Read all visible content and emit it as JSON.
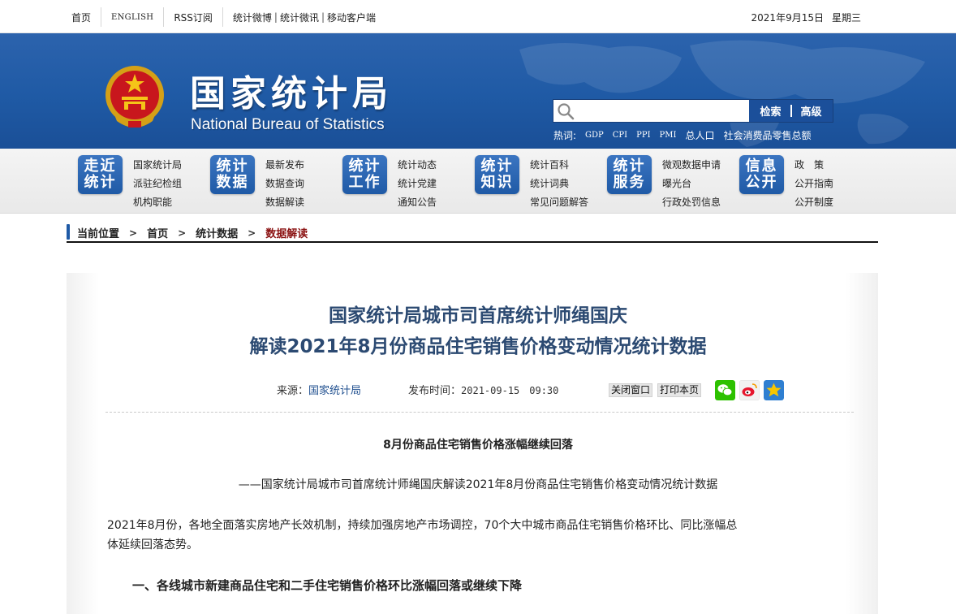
{
  "topbar": {
    "links": [
      "首页",
      "ENGLISH",
      "RSS订阅",
      "统计微博",
      "统计微讯",
      "移动客户端"
    ],
    "date": "2021年9月15日",
    "weekday": "星期三"
  },
  "header": {
    "logo_cn": "国家统计局",
    "logo_en": "National Bureau of Statistics",
    "search": {
      "placeholder": "",
      "button_search": "检索",
      "button_advanced": "高级"
    },
    "hot_label": "热词:",
    "hot_terms": [
      "GDP",
      "CPI",
      "PPI",
      "PMI",
      "总人口",
      "社会消费品零售总额"
    ]
  },
  "nav": {
    "categories": [
      {
        "badge_top": "走近",
        "badge_bottom": "统计",
        "items": [
          "国家统计局",
          "派驻纪检组",
          "机构职能"
        ]
      },
      {
        "badge_top": "统计",
        "badge_bottom": "数据",
        "items": [
          "最新发布",
          "数据查询",
          "数据解读"
        ]
      },
      {
        "badge_top": "统计",
        "badge_bottom": "工作",
        "items": [
          "统计动态",
          "统计党建",
          "通知公告"
        ]
      },
      {
        "badge_top": "统计",
        "badge_bottom": "知识",
        "items": [
          "统计百科",
          "统计词典",
          "常见问题解答"
        ]
      },
      {
        "badge_top": "统计",
        "badge_bottom": "服务",
        "items": [
          "微观数据申请",
          "曝光台",
          "行政处罚信息"
        ]
      },
      {
        "badge_top": "信息",
        "badge_bottom": "公开",
        "items": [
          "政　策",
          "公开指南",
          "公开制度"
        ]
      }
    ]
  },
  "breadcrumb": {
    "label": "当前位置",
    "items": [
      "首页",
      "统计数据"
    ],
    "current": "数据解读"
  },
  "article": {
    "title_line1": "国家统计局城市司首席统计师绳国庆",
    "title_line2": "解读2021年8月份商品住宅销售价格变动情况统计数据",
    "source_label": "来源：",
    "source_value": "国家统计局",
    "time_label": "发布时间：",
    "time_value": "2021-09-15　09:30",
    "close_button": "关闭窗口",
    "print_button": "打印本页",
    "subheading": "8月份商品住宅销售价格涨幅继续回落",
    "lead": "——国家统计局城市司首席统计师绳国庆解读2021年8月份商品住宅销售价格变动情况统计数据",
    "paragraph1_line1": "2021年8月份，各地全面落实房地产长效机制，持续加强房地产市场调控，70个大中城市商品住宅销售价格环比、同比涨幅总",
    "paragraph1_line2": "体延续回落态势。",
    "section1": "一、各线城市新建商品住宅和二手住宅销售价格环比涨幅回落或继续下降"
  },
  "colors": {
    "banner_blue": "#1f5aa5",
    "title_blue": "#2c4a72",
    "breadcrumb_current": "#8b1212"
  }
}
